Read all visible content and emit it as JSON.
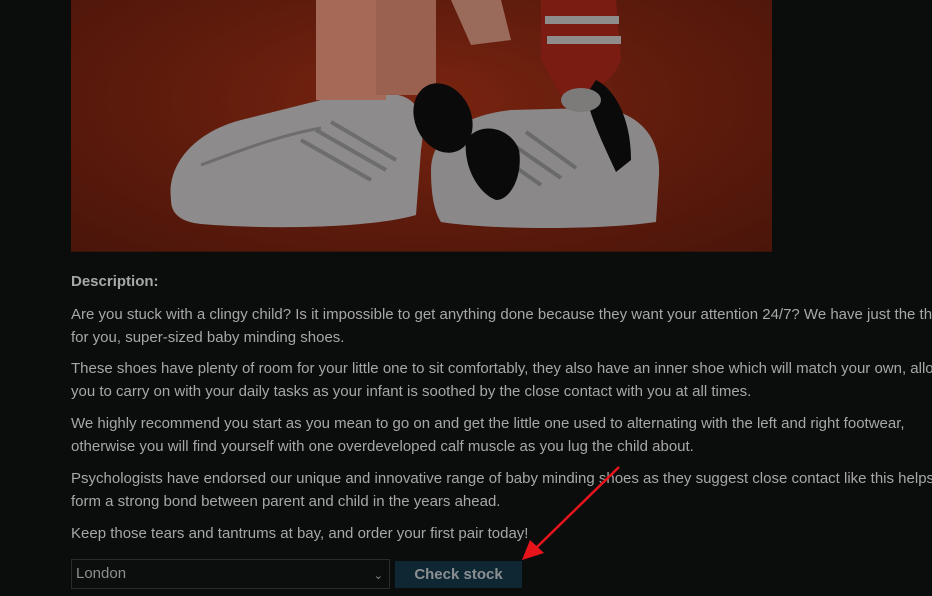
{
  "product": {
    "image_icon": "product-photo",
    "description_label": "Description:",
    "paragraphs": [
      "Are you stuck with a clingy child? Is it impossible to get anything done because they want your attention 24/7? We have just the thing for you, super-sized baby minding shoes.",
      "These shoes have plenty of room for your little one to sit comfortably, they also have an inner shoe which will match your own, allowing you to carry on with your daily tasks as your infant is soothed by the close contact with you at all times.",
      "We highly recommend you start as you mean to go on and get the little one used to alternating with the left and right footwear, otherwise you will find yourself with one overdeveloped calf muscle as you lug the child about.",
      "Psychologists have endorsed our unique and innovative range of baby minding shoes as they suggest close contact like this helps to form a strong bond between parent and child in the years ahead.",
      "Keep those tears and tantrums at bay, and order your first pair today!"
    ]
  },
  "stock_check": {
    "selected_store": "London",
    "button_label": "Check stock"
  },
  "colors": {
    "arrow": "#e8141c",
    "button_bg": "#0f2733"
  }
}
